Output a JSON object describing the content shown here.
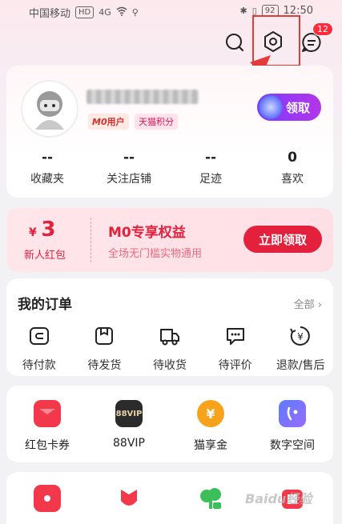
{
  "status_bar": {
    "carrier": "中国移动",
    "hd": "HD",
    "signal": "4G",
    "battery": "92",
    "time": "12:50"
  },
  "header": {
    "message_badge": "12"
  },
  "profile": {
    "tag_m0": "M0",
    "tag_m0_suffix": "用户",
    "tag_points": "天猫积分",
    "claim_label": "领取",
    "stats": [
      {
        "num": "--",
        "label": "收藏夹"
      },
      {
        "num": "--",
        "label": "关注店铺"
      },
      {
        "num": "--",
        "label": "足迹"
      },
      {
        "num": "0",
        "label": "喜欢"
      }
    ]
  },
  "coupon": {
    "currency": "¥",
    "amount": "3",
    "sub": "新人红包",
    "title": "M0专享权益",
    "desc": "全场无门槛实物通用",
    "button": "立即领取"
  },
  "orders": {
    "title": "我的订单",
    "all": "全部",
    "items": [
      {
        "label": "待付款",
        "icon": "wallet-icon"
      },
      {
        "label": "待发货",
        "icon": "package-icon"
      },
      {
        "label": "待收货",
        "icon": "truck-icon"
      },
      {
        "label": "待评价",
        "icon": "comment-icon"
      },
      {
        "label": "退款/售后",
        "icon": "refund-icon"
      }
    ]
  },
  "services": {
    "items": [
      {
        "label": "红包卡券",
        "icon": "red-packet-icon",
        "color": "#f2384a"
      },
      {
        "label": "88VIP",
        "icon": "vip-icon",
        "color": "#2b2b2b",
        "icon_text": "88VIP"
      },
      {
        "label": "猫享金",
        "icon": "coin-icon",
        "color": "#f7a21b",
        "icon_text": "¥"
      },
      {
        "label": "数字空间",
        "icon": "digital-space-icon",
        "color": "#6b7bff"
      }
    ]
  },
  "more": {
    "items": [
      {
        "icon": "record-icon",
        "color": "#f2384a"
      },
      {
        "icon": "flower-icon",
        "color": "#f2384a"
      },
      {
        "icon": "tree-icon",
        "color": "#3cbf5a"
      },
      {
        "icon": "gift-icon",
        "color": "#f2384a"
      }
    ]
  },
  "watermark": "Baidu经验"
}
